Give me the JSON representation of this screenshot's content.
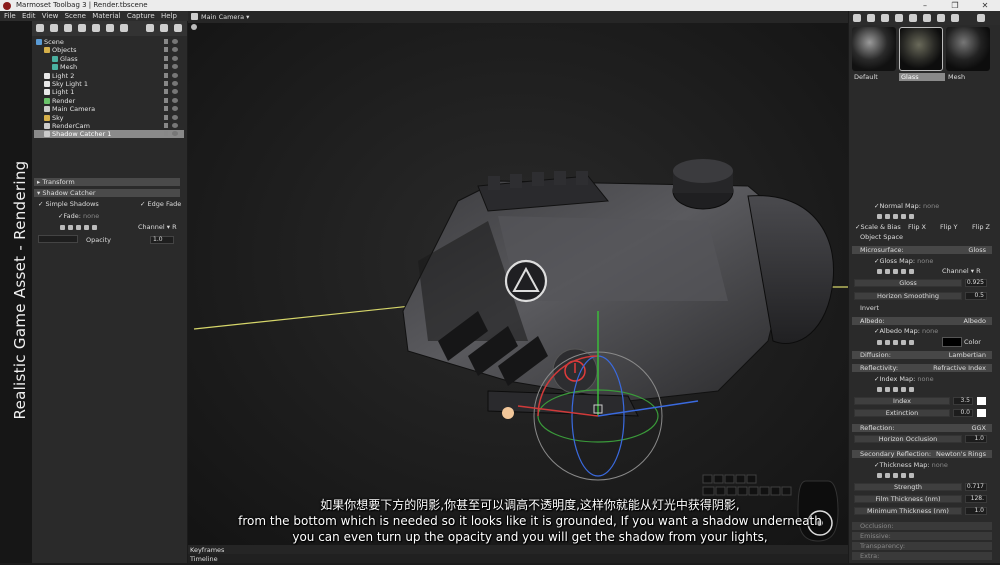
{
  "window": {
    "title": "Marmoset Toolbag 3  |  Render.tbscene",
    "minimize": "–",
    "maximize": "❐",
    "close": "✕"
  },
  "side_title": "Realistic Game Asset - Rendering",
  "menu": [
    "File",
    "Edit",
    "View",
    "Scene",
    "Material",
    "Capture",
    "Help"
  ],
  "scene_tree": [
    {
      "label": "Scene",
      "icon": "scene-icon",
      "color": "#5a9bd5",
      "indent": 0,
      "selected": false
    },
    {
      "label": "Objects",
      "icon": "folder-icon",
      "color": "#d6b04a",
      "indent": 1,
      "selected": false
    },
    {
      "label": "Glass",
      "icon": "mesh-icon",
      "color": "#4ab0a0",
      "indent": 2,
      "selected": false
    },
    {
      "label": "Mesh",
      "icon": "mesh-icon",
      "color": "#4ab0a0",
      "indent": 2,
      "selected": false
    },
    {
      "label": "Light 2",
      "icon": "light-icon",
      "color": "#e8e8e8",
      "indent": 1,
      "selected": false
    },
    {
      "label": "Sky Light 1",
      "icon": "light-icon",
      "color": "#e8e8e8",
      "indent": 1,
      "selected": false
    },
    {
      "label": "Light 1",
      "icon": "light-icon",
      "color": "#e8e8e8",
      "indent": 1,
      "selected": false
    },
    {
      "label": "Render",
      "icon": "render-icon",
      "color": "#6ac36a",
      "indent": 1,
      "selected": false
    },
    {
      "label": "Main Camera",
      "icon": "camera-icon",
      "color": "#cccccc",
      "indent": 1,
      "selected": false
    },
    {
      "label": "Sky",
      "icon": "sky-icon",
      "color": "#d6b04a",
      "indent": 1,
      "selected": false
    },
    {
      "label": "RenderCam",
      "icon": "camera-icon",
      "color": "#cccccc",
      "indent": 1,
      "selected": false
    },
    {
      "label": "Shadow Catcher 1",
      "icon": "shadow-catcher-icon",
      "color": "#cccccc",
      "indent": 1,
      "selected": true
    }
  ],
  "left_props": {
    "transform_header": "Transform",
    "shadow_catcher_header": "Shadow Catcher",
    "simple_shadows": "Simple Shadows",
    "edge_fade": "Edge Fade",
    "fade_label": "Fade:",
    "fade_value": "none",
    "channel_label": "Channel",
    "channel_value": "R",
    "opacity_label": "Opacity",
    "opacity_value": "1.0"
  },
  "viewport": {
    "camera_label": "Main Camera",
    "keyframes_label": "Keyframes",
    "timeline_label": "Timeline"
  },
  "materials": [
    {
      "label": "Default",
      "selected": false
    },
    {
      "label": "Glass",
      "selected": true
    },
    {
      "label": "Mesh",
      "selected": false
    }
  ],
  "right_props": {
    "normal_map_label": "Normal Map:",
    "normal_map_value": "none",
    "scale_bias": "Scale & Bias",
    "flip_x": "Flip X",
    "flip_y": "Flip Y",
    "flip_z": "Flip Z",
    "object_space": "Object Space",
    "microsurface": {
      "label": "Microsurface:",
      "value": "Gloss"
    },
    "gloss_map_label": "Gloss Map:",
    "gloss_map_value": "none",
    "gloss_channel_label": "Channel",
    "gloss_channel_value": "R",
    "gloss_label": "Gloss",
    "gloss_value": "0.925",
    "horizon_smoothing_label": "Horizon Smoothing",
    "horizon_smoothing_value": "0.5",
    "invert_label": "Invert",
    "albedo": {
      "label": "Albedo:",
      "value": "Albedo"
    },
    "albedo_map_label": "Albedo Map:",
    "albedo_map_value": "none",
    "color_label": "Color",
    "diffusion": {
      "label": "Diffusion:",
      "value": "Lambertian"
    },
    "reflectivity": {
      "label": "Reflectivity:",
      "value": "Refractive Index"
    },
    "index_map_label": "Index Map:",
    "index_map_value": "none",
    "index_label": "Index",
    "index_value": "3.5",
    "extinction_label": "Extinction",
    "extinction_value": "0.0",
    "reflection": {
      "label": "Reflection:",
      "value": "GGX"
    },
    "horizon_occlusion_label": "Horizon Occlusion",
    "horizon_occlusion_value": "1.0",
    "secondary_reflection": {
      "label": "Secondary Reflection:",
      "value": "Newton's Rings"
    },
    "thickness_map_label": "Thickness Map:",
    "thickness_map_value": "none",
    "strength_label": "Strength",
    "strength_value": "0.717",
    "film_thickness_label": "Film Thickness (nm)",
    "film_thickness_value": "128.",
    "min_thickness_label": "Minimum Thickness (nm)",
    "min_thickness_value": "1.0",
    "occlusion_label": "Occlusion:",
    "emissive_label": "Emissive:",
    "transparency_label": "Transparency:",
    "extra_label": "Extra:"
  },
  "subtitles": {
    "line_cn": "如果你想要下方的阴影,你甚至可以调高不透明度,这样你就能从灯光中获得阴影,",
    "line_en1": "from the bottom which is needed so it looks like it is grounded, If you want a shadow underneath",
    "line_en2": "you can even turn up the opacity and you will get the shadow from your lights,"
  }
}
